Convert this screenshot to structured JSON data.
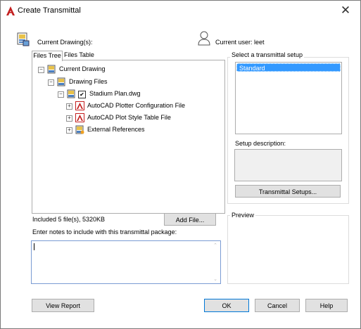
{
  "window": {
    "title": "Create Transmittal",
    "close_glyph": "✕",
    "accent_color": "#c31f1f"
  },
  "header": {
    "current_drawings_label": "Current Drawing(s):",
    "current_user_label": "Current user: leet"
  },
  "tabs": [
    {
      "label": "Files Tree",
      "active": true
    },
    {
      "label": "Files Table",
      "active": false
    }
  ],
  "tree": {
    "nodes": [
      {
        "label": "Current Drawing",
        "icon": "drawing-folder-icon",
        "expander": "⊟"
      },
      {
        "label": "Drawing Files",
        "icon": "drawing-folder-icon",
        "expander": "⊟"
      },
      {
        "label": "Stadium Plan.dwg",
        "icon": "dwg-file-icon",
        "expander": "⊟",
        "checked": true
      },
      {
        "label": "AutoCAD Plotter Configuration File",
        "icon": "autocad-icon",
        "expander": "⊞"
      },
      {
        "label": "AutoCAD Plot Style Table File",
        "icon": "autocad-icon",
        "expander": "⊞"
      },
      {
        "label": "External References",
        "icon": "xref-icon",
        "expander": "⊞"
      }
    ],
    "check_glyph": "✔"
  },
  "summary": {
    "included_text": "Included 5 file(s), 5320KB",
    "add_file_label": "Add File..."
  },
  "notes": {
    "label": "Enter notes to include with this transmittal package:",
    "value": ""
  },
  "setup": {
    "group_label": "Select a transmittal setup",
    "items": [
      "Standard"
    ],
    "selected": "Standard",
    "description_label": "Setup description:",
    "description_value": "",
    "setups_button_label": "Transmittal Setups..."
  },
  "preview": {
    "label": "Preview"
  },
  "footer": {
    "view_report_label": "View Report",
    "ok_label": "OK",
    "cancel_label": "Cancel",
    "help_label": "Help"
  }
}
